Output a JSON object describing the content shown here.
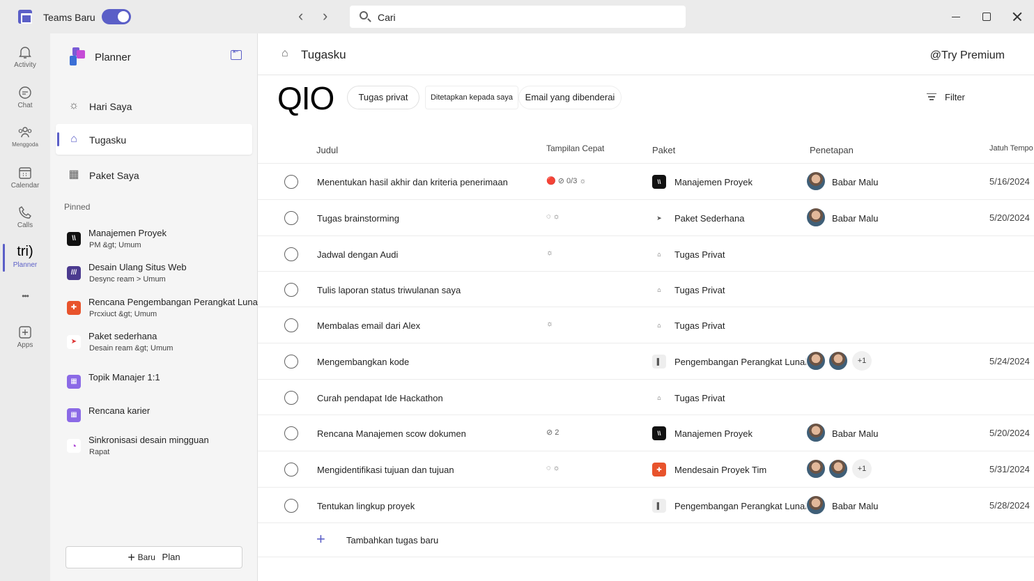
{
  "titlebar": {
    "app_title": "Teams Baru",
    "search_placeholder": "Cari",
    "back": "‹",
    "forward": "›"
  },
  "rail": [
    {
      "label": "Activity",
      "icon": "bell-icon"
    },
    {
      "label": "Chat",
      "icon": "chat-icon"
    },
    {
      "label": "Menggoda",
      "icon": "people-icon"
    },
    {
      "label": "Calendar",
      "icon": "calendar-icon"
    },
    {
      "label": "Calls",
      "icon": "phone-icon"
    },
    {
      "label": "Planner",
      "icon_text": "tri)"
    },
    {
      "label": "",
      "icon_text": "•••"
    },
    {
      "label": "Apps",
      "icon": "plus-square-icon"
    }
  ],
  "sidebar": {
    "title": "Planner",
    "nav": [
      {
        "label": "Hari Saya",
        "icon": "sun-icon"
      },
      {
        "label": "Tugasku",
        "icon": "home-check-icon"
      },
      {
        "label": "Paket Saya",
        "icon": "grid-icon"
      }
    ],
    "pinned_header": "Pinned",
    "pinned": [
      {
        "name": "Manajemen Proyek",
        "sub": "PM &gt; Umum",
        "color": "#111111",
        "glyph": "\\\\"
      },
      {
        "name": "Desain Ulang Situs Web",
        "sub": "Desync ream  > Umum",
        "color": "#4b3a8f",
        "glyph": "///"
      },
      {
        "name": "Rencana Pengembangan Perangkat Lunak",
        "sub": "Prcxiuct &gt; Umum",
        "color": "#e8532c",
        "glyph": "✚"
      },
      {
        "name": "Paket sederhana",
        "sub": "Desain ream &gt; Umum",
        "color": "#ffffff",
        "glyph": "➤"
      },
      {
        "name": "Topik Manajer 1:1",
        "sub": "",
        "color": "#8b6ae6",
        "glyph": "▦"
      },
      {
        "name": "Rencana karier",
        "sub": "",
        "color": "#8b6ae6",
        "glyph": "▦"
      },
      {
        "name": "Sinkronisasi desain mingguan",
        "sub": "Rapat",
        "color": "#b04bd6",
        "glyph": "◔"
      }
    ],
    "new_plan_label": "Baru",
    "new_plan_label2": "Plan"
  },
  "main": {
    "title": "Tugasku",
    "premium": "@Try Premium",
    "logo_text": "QIO",
    "pills": [
      "Tugas privat",
      "Ditetapkan kepada saya",
      "Email yang dibenderai"
    ],
    "filter": "Filter",
    "columns": {
      "title": "Judul",
      "quick": "Tampilan Cepat",
      "plan": "Paket",
      "assign": "Penetapan",
      "due": "Jatuh Tempo"
    },
    "rows": [
      {
        "task": "Menentukan hasil akhir dan kriteria penerimaan",
        "quick": "🔴  ⊘ 0/3   ☼",
        "plan": "Manajemen Proyek",
        "plan_color": "#111111",
        "plan_glyph": "\\\\",
        "assignee": "Babar Malu",
        "avatars": 1,
        "extra": "",
        "due": "5/16/2024"
      },
      {
        "task": "Tugas brainstorming",
        "quick": "◌  ☼",
        "plan": "Paket Sederhana",
        "plan_color": "#ffffff",
        "plan_glyph": "➤",
        "assignee": "Babar Malu",
        "avatars": 1,
        "extra": "",
        "due": "5/20/2024"
      },
      {
        "task": "Jadwal dengan Audi",
        "quick": "☼",
        "plan": "Tugas Privat",
        "plan_color": "#ffffff",
        "plan_glyph": "⌂",
        "assignee": "",
        "avatars": 0,
        "extra": "",
        "due": ""
      },
      {
        "task": "Tulis laporan status triwulanan saya",
        "quick": "",
        "plan": "Tugas Privat",
        "plan_color": "#ffffff",
        "plan_glyph": "⌂",
        "assignee": "",
        "avatars": 0,
        "extra": "",
        "due": ""
      },
      {
        "task": "Membalas email dari Alex",
        "quick": "☼",
        "plan": "Tugas Privat",
        "plan_color": "#ffffff",
        "plan_glyph": "⌂",
        "assignee": "",
        "avatars": 0,
        "extra": "",
        "due": ""
      },
      {
        "task": "Mengembangkan kode",
        "quick": "",
        "plan": "Pengembangan Perangkat Lunak",
        "plan_color": "#eeeeee",
        "plan_glyph": "▌",
        "assignee": "",
        "avatars": 2,
        "extra": "+1",
        "due": "5/24/2024"
      },
      {
        "task": "Curah pendapat Ide Hackathon",
        "quick": "",
        "plan": "Tugas Privat",
        "plan_color": "#ffffff",
        "plan_glyph": "⌂",
        "assignee": "",
        "avatars": 0,
        "extra": "",
        "due": ""
      },
      {
        "task": "Rencana Manajemen scow dokumen",
        "quick": "⊘ 2",
        "plan": "Manajemen Proyek",
        "plan_color": "#111111",
        "plan_glyph": "\\\\",
        "assignee": "Babar Malu",
        "avatars": 1,
        "extra": "",
        "due": "5/20/2024"
      },
      {
        "task": "Mengidentifikasi tujuan dan tujuan",
        "quick": "◌  ☼",
        "plan": "Mendesain Proyek Tim",
        "plan_color": "#e8532c",
        "plan_glyph": "✚",
        "assignee": "",
        "avatars": 2,
        "extra": "+1",
        "due": "5/31/2024"
      },
      {
        "task": "Tentukan lingkup proyek",
        "quick": "",
        "plan": "Pengembangan Perangkat Lunak",
        "plan_color": "#eeeeee",
        "plan_glyph": "▌",
        "assignee": "Babar Malu",
        "avatars": 1,
        "extra": "",
        "due": "5/28/2024"
      }
    ],
    "add_task": "Tambahkan tugas baru"
  }
}
